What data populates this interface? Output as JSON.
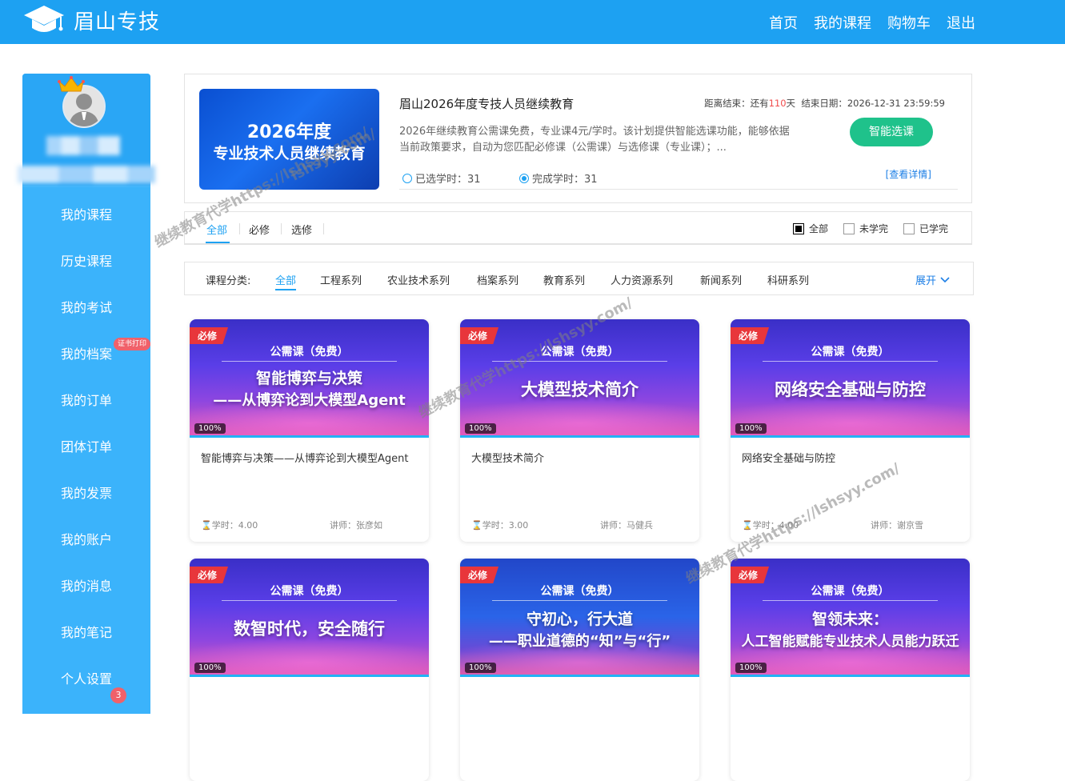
{
  "header": {
    "brand": "眉山专技",
    "nav": [
      "首页",
      "我的课程",
      "购物车",
      "退出"
    ]
  },
  "sidebar": {
    "items": [
      "我的课程",
      "历史课程",
      "我的考试",
      "我的档案",
      "我的订单",
      "团体订单",
      "我的发票",
      "我的账户",
      "我的消息",
      "我的笔记",
      "个人设置"
    ],
    "cert_badge": "证书打印",
    "msg_count": "3"
  },
  "plan": {
    "banner_line1": "2026年度",
    "banner_line2": "专业技术人员继续教育",
    "title": "眉山2026年度专技人员继续教育",
    "countdown_prefix": "距离结束：还有",
    "countdown_days": "110",
    "countdown_suffix": "天",
    "end_date_label": "结束日期：2026-12-31 23:59:59",
    "description": "2026年继续教育公需课免费，专业课4元/学时。该计划提供智能选课功能，能够依据当前政策要求，自动为您匹配必修课（公需课）与选修课（专业课）；...",
    "selected_label": "已选学时：31",
    "completed_label": "完成学时：31",
    "smart_button": "智能选课",
    "detail_link": "[查看详情]"
  },
  "tabs": {
    "items": [
      "全部",
      "必修",
      "选修"
    ],
    "filters": [
      "全部",
      "未学完",
      "已学完"
    ]
  },
  "categories": {
    "label": "课程分类:",
    "items": [
      "全部",
      "工程系列",
      "农业技术系列",
      "档案系列",
      "教育系列",
      "人力资源系列",
      "新闻系列",
      "科研系列"
    ],
    "expand": "展开"
  },
  "courses": [
    {
      "tag": "必修",
      "kicker": "公需课（免费）",
      "headline1": "智能博弈与决策",
      "headline2": "——从博弈论到大模型Agent",
      "progress": "100%",
      "title": "智能博弈与决策——从博弈论到大模型Agent",
      "hours": "学时：4.00",
      "teacher": "讲师：张彦如"
    },
    {
      "tag": "必修",
      "kicker": "公需课（免费）",
      "headline1": "大模型技术简介",
      "headline2": "",
      "progress": "100%",
      "title": "大模型技术简介",
      "hours": "学时：3.00",
      "teacher": "讲师：马健兵"
    },
    {
      "tag": "必修",
      "kicker": "公需课（免费）",
      "headline1": "网络安全基础与防控",
      "headline2": "",
      "progress": "100%",
      "title": "网络安全基础与防控",
      "hours": "学时：4.00",
      "teacher": "讲师：谢京雪"
    },
    {
      "tag": "必修",
      "kicker": "公需课（免费）",
      "headline1": "数智时代，安全随行",
      "headline2": "",
      "progress": "100%"
    },
    {
      "tag": "必修",
      "kicker": "公需课（免费）",
      "headline1": "守初心，行大道",
      "headline2": "——职业道德的“知”与“行”",
      "progress": "100%"
    },
    {
      "tag": "必修",
      "kicker": "公需课（免费）",
      "headline1": "智领未来：",
      "headline2": "人工智能赋能专业技术人员能力跃迁",
      "progress": "100%"
    }
  ],
  "watermark": {
    "text1": "继续教育代学https://lshsyy.com/",
    "text2": "lshsyy.com/"
  },
  "colors": {
    "primary": "#1da1f2",
    "sidebar": "#3bb3fb",
    "success": "#1fc28b",
    "danger": "#e8363b"
  }
}
